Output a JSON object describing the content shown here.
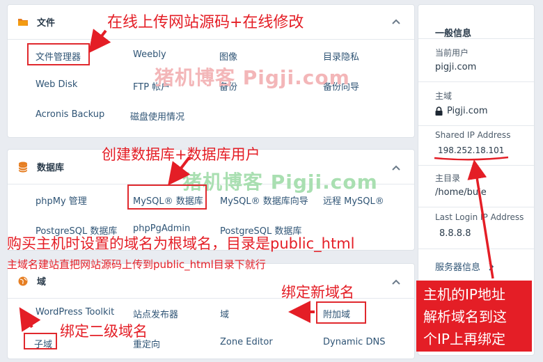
{
  "files_panel": {
    "title": "文件",
    "items": [
      "文件管理器",
      "Weebly",
      "图像",
      "目录隐私",
      "Web Disk",
      "FTP 帐户",
      "备份",
      "备份向导",
      "Acronis Backup",
      "磁盘使用情况"
    ]
  },
  "db_panel": {
    "title": "数据库",
    "items": [
      "phpMy 管理",
      "MySQL® 数据库",
      "MySQL® 数据库向导",
      "远程 MySQL®",
      "PostgreSQL 数据库",
      "phpPgAdmin",
      "PostgreSQL 数据库"
    ]
  },
  "domain_panel": {
    "title": "域",
    "items": [
      "WordPress Toolkit",
      "站点发布器",
      "域",
      "附加域",
      "子域",
      "重定向",
      "Zone Editor",
      "Dynamic DNS"
    ]
  },
  "sidebar": {
    "heading": "一般信息",
    "current_user_label": "当前用户",
    "current_user": "pigji.com",
    "main_domain_label": "主域",
    "main_domain": "Pigji.com",
    "shared_ip_label": "Shared IP Address",
    "shared_ip": "198.252.18.101",
    "home_dir_label": "主目录",
    "home_dir": "/home/bule",
    "last_login_label": "Last Login IP Address",
    "last_login_ip": "8.8.8.8",
    "server_info": "服务器信息"
  },
  "annotations": {
    "file_note": "在线上传网站源码+在线修改",
    "db_note": "创建数据库+数据库用户",
    "root_note": "购买主机时设置的域名为根域名，目录是public_html",
    "root_sub_note": "主域名建站直把网站源码上传到public_html目录下就行",
    "addon_note": "绑定新域名",
    "sub_note": "绑定二级域名",
    "ip_note_lines": [
      "主机的IP地址",
      "解析域名到这",
      "个IP上再绑定"
    ]
  },
  "watermark": "猪机博客 Pigji.com",
  "colors": {
    "annotation": "#e41e26",
    "link": "#2f5475",
    "watermark_red": "#f3b6b8",
    "watermark_green": "#a9dfb1"
  }
}
